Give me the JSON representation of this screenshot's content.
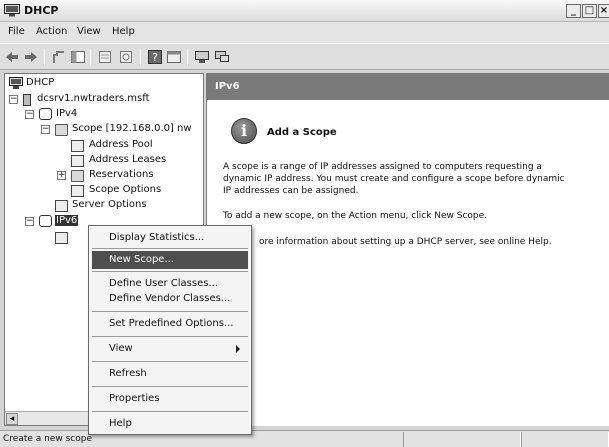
{
  "window": {
    "title": "DHCP"
  },
  "menubar": [
    "File",
    "Action",
    "View",
    "Help"
  ],
  "toolbar": {
    "icons": [
      "back-arrow-icon",
      "forward-arrow-icon",
      "up-folder-icon",
      "show-hide-tree-icon",
      "properties-icon",
      "refresh-icon",
      "help-icon",
      "console-icon",
      "computer-icon",
      "network-icon"
    ]
  },
  "tree": {
    "root": "DHCP",
    "server": "dcsrv1.nwtraders.msft",
    "ipv4": "IPv4",
    "scope": "Scope [192.168.0.0] nw",
    "address_pool": "Address Pool",
    "address_leases": "Address Leases",
    "reservations": "Reservations",
    "scope_options": "Scope Options",
    "server_options": "Server Options",
    "ipv6": "IPv6"
  },
  "rightpane": {
    "header": "IPv6",
    "add_title": "Add a Scope",
    "para1_line1": "A scope is a range of IP addresses assigned to computers requesting a",
    "para1_line2": "dynamic IP address. You must create and configure a scope before dynamic",
    "para1_line3": "IP addresses can be assigned.",
    "para2": "To add a new scope, on the Action menu, click New Scope.",
    "para3": "ore information about setting up a DHCP server, see online Help."
  },
  "context_menu": {
    "items": [
      "Display Statistics...",
      "New Scope...",
      "Define User Classes...",
      "Define Vendor Classes...",
      "Set Predefined Options...",
      "View",
      "Refresh",
      "Properties",
      "Help"
    ],
    "selected": "New Scope..."
  },
  "status": {
    "text": "Create a new scope"
  }
}
